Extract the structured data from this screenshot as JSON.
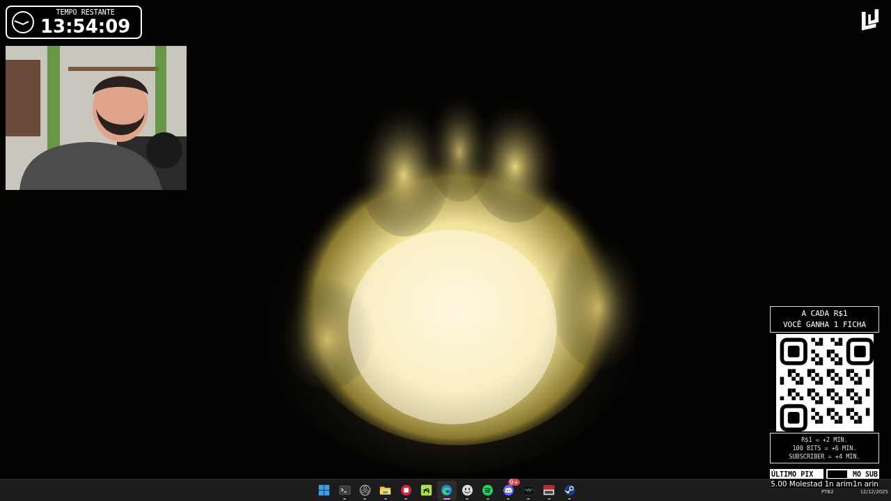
{
  "timer": {
    "label": "TEMPO RESTANTE",
    "time": "13:54:09"
  },
  "promo": {
    "headline": [
      "A CADA R$1",
      "VOCÊ GANHA 1 FICHA"
    ],
    "rates": [
      "R$1 = +2 MIN.",
      "100 BITS = +6 MIN.",
      "SUBSCRIBER = +4 MIN."
    ],
    "labels": [
      {
        "text": "ÚLTIMO PIX",
        "covered": false
      },
      {
        "text": "MO SUB",
        "covered": true
      }
    ],
    "ticker": [
      "5.00 Molestad",
      "1n arim1n arin"
    ]
  },
  "taskbar": {
    "apps": [
      {
        "kind": "start",
        "selected": false,
        "running": false
      },
      {
        "kind": "terminal",
        "selected": false,
        "running": true
      },
      {
        "kind": "ring",
        "selected": false,
        "running": true
      },
      {
        "kind": "folder",
        "selected": false,
        "running": true
      },
      {
        "kind": "fist",
        "selected": false,
        "running": true
      },
      {
        "kind": "tile",
        "selected": false,
        "running": false
      },
      {
        "kind": "swirl",
        "selected": true,
        "running": true
      },
      {
        "kind": "smiley",
        "selected": false,
        "running": true
      },
      {
        "kind": "waves",
        "selected": false,
        "running": true
      },
      {
        "kind": "controller",
        "selected": false,
        "running": true,
        "badge": "9+"
      },
      {
        "kind": "waveform",
        "selected": false,
        "running": true
      },
      {
        "kind": "banner",
        "selected": false,
        "running": true
      },
      {
        "kind": "joint",
        "selected": false,
        "running": true
      }
    ],
    "tray": {
      "language": "PTB2",
      "date": "12/12/2025"
    }
  }
}
